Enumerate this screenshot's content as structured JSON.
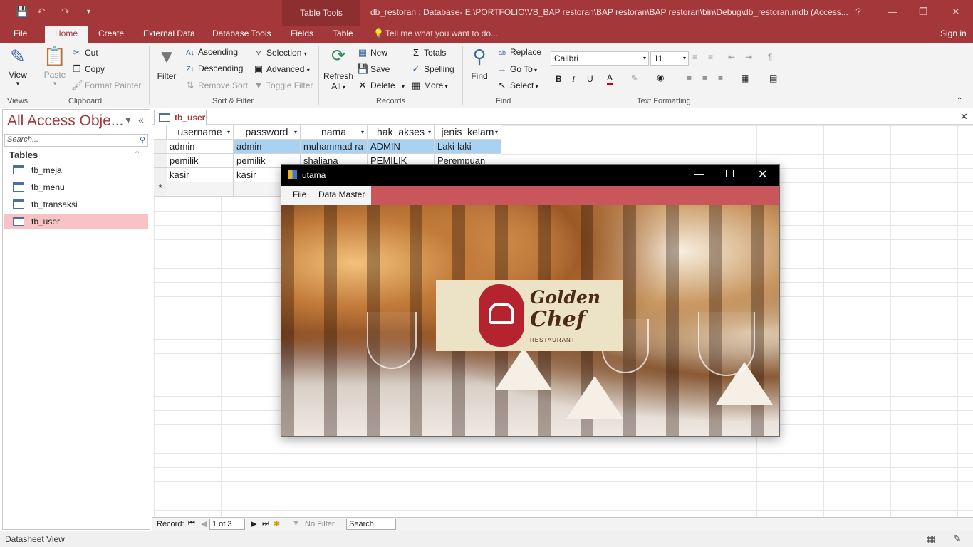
{
  "titlebar": {
    "context_tab": "Table Tools",
    "doc_title": "db_restoran : Database- E:\\PORTFOLIO\\VB_BAP restoran\\BAP restoran\\BAP restoran\\bin\\Debug\\db_restoran.mdb (Access..."
  },
  "ribbon_tabs": [
    "File",
    "Home",
    "Create",
    "External Data",
    "Database Tools",
    "Fields",
    "Table"
  ],
  "tell_me": "Tell me what you want to do...",
  "sign_in": "Sign in",
  "groups": {
    "views": {
      "label": "Views",
      "view": "View"
    },
    "clipboard": {
      "label": "Clipboard",
      "paste": "Paste",
      "cut": "Cut",
      "copy": "Copy",
      "format_painter": "Format Painter"
    },
    "sort_filter": {
      "label": "Sort & Filter",
      "filter": "Filter",
      "ascending": "Ascending",
      "descending": "Descending",
      "remove_sort": "Remove Sort",
      "selection": "Selection",
      "advanced": "Advanced",
      "toggle_filter": "Toggle Filter"
    },
    "records": {
      "label": "Records",
      "refresh": "Refresh",
      "refresh2": "All",
      "new": "New",
      "save": "Save",
      "delete": "Delete",
      "totals": "Totals",
      "spelling": "Spelling",
      "more": "More"
    },
    "find": {
      "label": "Find",
      "find": "Find",
      "replace": "Replace",
      "goto": "Go To",
      "select": "Select"
    },
    "text_formatting": {
      "label": "Text Formatting",
      "font": "Calibri",
      "size": "11",
      "bold": "B",
      "italic": "I",
      "underline": "U"
    }
  },
  "nav": {
    "title": "All Access Obje...",
    "search_placeholder": "Search...",
    "section": "Tables",
    "items": [
      "tb_meja",
      "tb_menu",
      "tb_transaksi",
      "tb_user"
    ],
    "selected": "tb_user"
  },
  "doc_tab": "tb_user",
  "table": {
    "columns": [
      "username",
      "password",
      "nama",
      "hak_akses",
      "jenis_kelam"
    ],
    "rows": [
      [
        "admin",
        "admin",
        "muhammad ra",
        "ADMIN",
        "Laki-laki"
      ],
      [
        "pemilik",
        "pemilik",
        "shaliana",
        "PEMILIK",
        "Perempuan"
      ],
      [
        "kasir",
        "kasir",
        "",
        "",
        ""
      ]
    ],
    "new_row_marker": "*"
  },
  "record_nav": {
    "label": "Record:",
    "position": "1 of 3",
    "filter": "No Filter",
    "search": "Search"
  },
  "status": "Datasheet View",
  "form": {
    "title": "utama",
    "menu": [
      "File",
      "Data Master"
    ],
    "logo_line1": "Golden",
    "logo_line2": "Chef",
    "logo_sub": "RESTAURANT"
  },
  "colors": {
    "access_red": "#a4373a",
    "menu_bar": "#c8565a",
    "selection": "#a9d1f1"
  }
}
